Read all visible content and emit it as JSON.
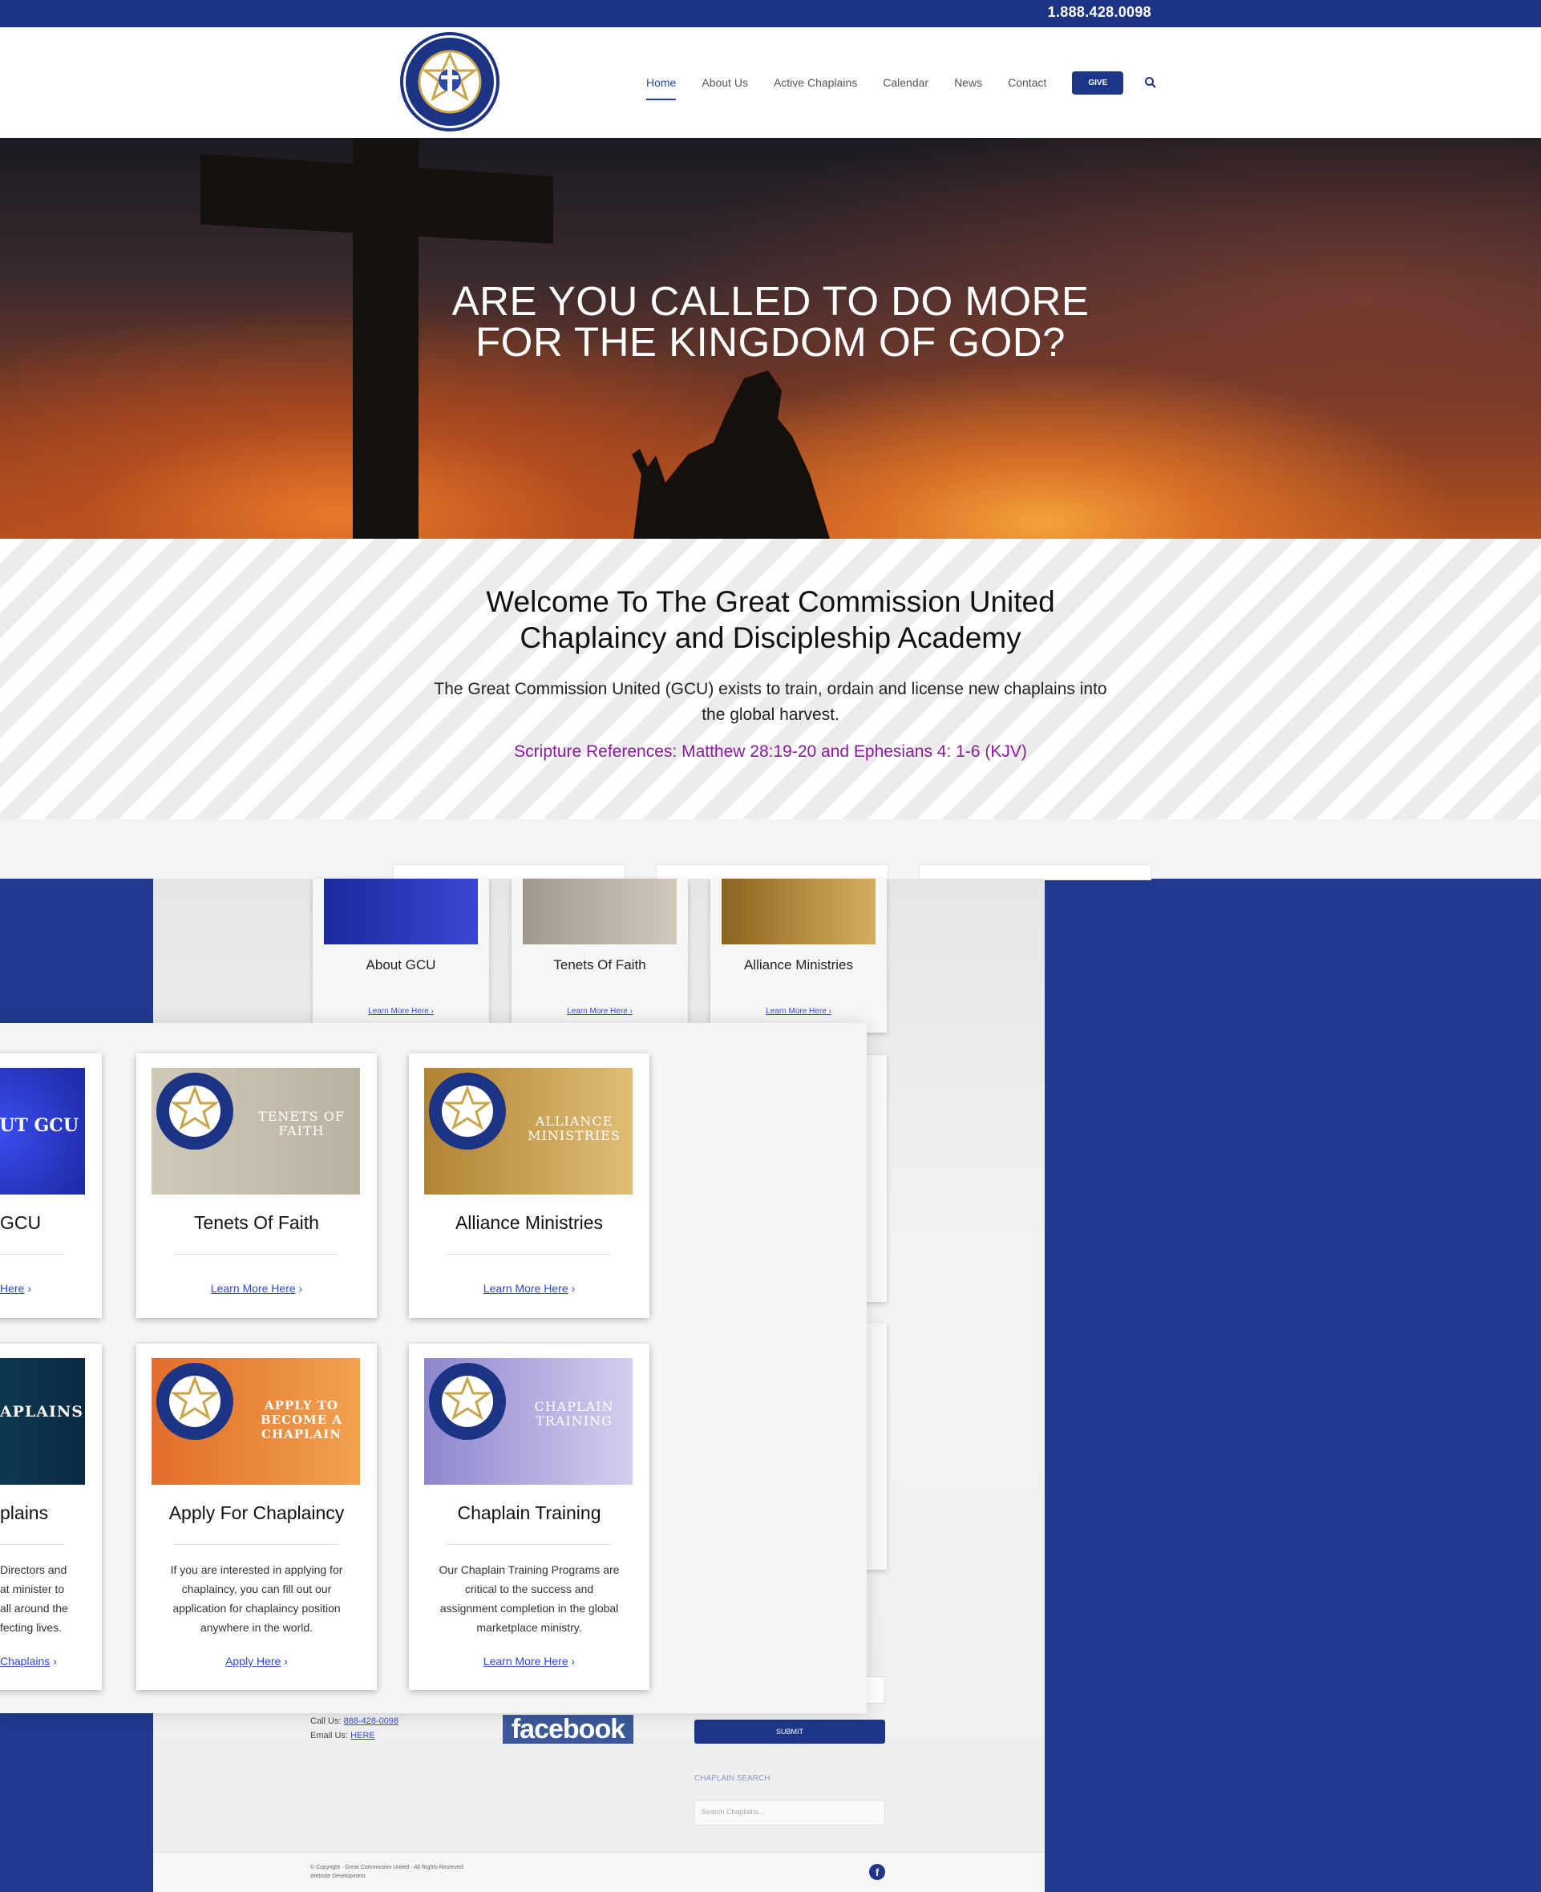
{
  "topbar": {
    "phone": "1.888.428.0098"
  },
  "header": {
    "nav": [
      {
        "label": "Home",
        "active": true
      },
      {
        "label": "About Us"
      },
      {
        "label": "Active Chaplains"
      },
      {
        "label": "Calendar"
      },
      {
        "label": "News"
      },
      {
        "label": "Contact"
      }
    ],
    "give_label": "GIVE",
    "logo_text_top": "GREAT COMMISSION",
    "logo_text_bottom": "UNITED"
  },
  "hero": {
    "line1": "ARE YOU CALLED TO DO MORE",
    "line2": "FOR THE KINGDOM OF GOD?"
  },
  "welcome": {
    "title_line1": "Welcome To The Great Commission United",
    "title_line2": "Chaplaincy and Discipleship Academy",
    "lead_line1": "The Great Commission United (GCU) exists to train, ordain and license new chaplains into",
    "lead_line2": "the global harvest.",
    "scripture": "Scripture References: Matthew 28:19-20 and Ephesians 4: 1-6 (KJV)"
  },
  "background_cards": [
    {
      "title": "About GCU",
      "link": "Learn More Here",
      "banner": "ABOUT GCU",
      "color": "#2a36b8"
    },
    {
      "title": "Tenets Of Faith",
      "link": "Learn More Here",
      "banner": "TENETS OF FAITH",
      "color": "#b5ae9c"
    },
    {
      "title": "Alliance Ministries",
      "link": "Learn More Here",
      "banner": "ALLIANCE MINISTRIES",
      "color": "#b88a36"
    }
  ],
  "background_footer": {
    "call_label": "Call Us:",
    "call_value": "888-428-0098",
    "email_label": "Email Us:",
    "email_value": "HERE",
    "facebook": "facebook",
    "submit": "SUBMIT",
    "chaplain_search_label": "CHAPLAIN SEARCH",
    "chaplain_search_placeholder": "Search Chaplains...",
    "fb_icon": "f"
  },
  "cards_row1": [
    {
      "title": "GCU",
      "link": "Here",
      "banner": "ABOUT GCU"
    },
    {
      "title": "Tenets Of Faith",
      "link": "Learn More Here",
      "banner": "TENETS OF FAITH"
    },
    {
      "title": "Alliance Ministries",
      "link": "Learn More Here",
      "banner": "ALLIANCE MINISTRIES"
    }
  ],
  "cards_row2": [
    {
      "title": "plains",
      "banner": "ACTIVE CHAPLAINS",
      "desc": [
        "Directors and",
        "at minister to",
        "all around the",
        "fecting lives."
      ],
      "link": "Chaplains"
    },
    {
      "title": "Apply For Chaplaincy",
      "banner": "APPLY TO BECOME A CHAPLAIN",
      "desc": [
        "If you are interested in applying for",
        "chaplaincy, you can fill out our",
        "application for chaplaincy position",
        "anywhere in the world."
      ],
      "link": "Apply Here"
    },
    {
      "title": "Chaplain Training",
      "banner": "CHAPLAIN TRAINING",
      "desc": [
        "Our Chaplain Training Programs are",
        "critical to the success and",
        "assignment completion in the global",
        "marketplace ministry."
      ],
      "link": "Learn More Here"
    }
  ],
  "colors": {
    "navy": "#1d3485",
    "link": "#2c49d8",
    "scripture": "#8a1a9b"
  }
}
